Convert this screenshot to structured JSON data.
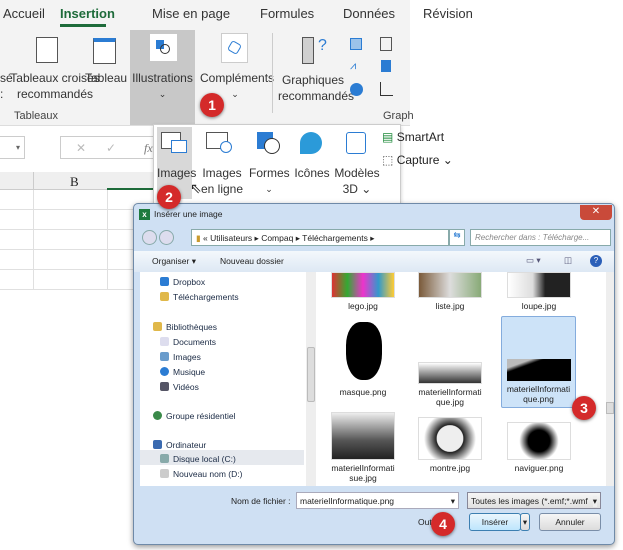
{
  "ribbon": {
    "tabs": [
      "Accueil",
      "Insertion",
      "Mise en page",
      "Formules",
      "Données",
      "Révision"
    ],
    "active_tab": "Insertion",
    "buttons": {
      "pivot_cut_1": "sé",
      "pivot_cut_2": ":",
      "pivot_recommended": "Tableaux croisés",
      "pivot_recommended_2": "recommandés",
      "table": "Tableau",
      "illustrations": "Illustrations",
      "addins": "Compléments",
      "charts_recommended": "Graphiques",
      "charts_recommended_2": "recommandés"
    },
    "groups": {
      "tables": "Tableaux",
      "charts": "Graph"
    },
    "accent": "#1e6b3a"
  },
  "sheet": {
    "column_b": "B",
    "fx": "fx"
  },
  "illustrations_menu": {
    "images": "Images",
    "online_1": "Images",
    "online_2": "en ligne",
    "shapes": "Formes",
    "icons": "Icônes",
    "models_1": "Modèles",
    "models_2": "3D",
    "smartart": "SmartArt",
    "capture": "Capture"
  },
  "dialog": {
    "title": "Insérer une image",
    "breadcrumb": [
      "Utilisateurs",
      "Compaq",
      "Téléchargements"
    ],
    "search_placeholder": "Rechercher dans : Télécharge...",
    "toolbar": {
      "organize": "Organiser",
      "new_folder": "Nouveau dossier"
    },
    "nav": [
      "Dropbox",
      "Téléchargements",
      "Bibliothèques",
      "Documents",
      "Images",
      "Musique",
      "Vidéos",
      "Groupe résidentiel",
      "Ordinateur",
      "Disque local (C:)",
      "Nouveau nom (D:)"
    ],
    "files": [
      {
        "name": "lego.jpg"
      },
      {
        "name": "liste.jpg"
      },
      {
        "name": "loupe.jpg"
      },
      {
        "name": "masque.png"
      },
      {
        "name": "materielInformatique.jpg",
        "l1": "materielInformati",
        "l2": "que.jpg"
      },
      {
        "name": "materielInformatique.png",
        "l1": "materielInformati",
        "l2": "que.png",
        "selected": true
      },
      {
        "name": "materielInformatisue.jpg",
        "l1": "materielInformati",
        "l2": "sue.jpg"
      },
      {
        "name": "montre.jpg"
      },
      {
        "name": "naviguer.png"
      }
    ],
    "filename_label": "Nom de fichier :",
    "filename_value": "materielInformatique.png",
    "filter": "Toutes les images (*.emf;*.wmf",
    "tools": "Outils",
    "insert": "Insérer",
    "cancel": "Annuler"
  },
  "badges": [
    "1",
    "2",
    "3",
    "4"
  ],
  "badge_color": "#d42a2a"
}
